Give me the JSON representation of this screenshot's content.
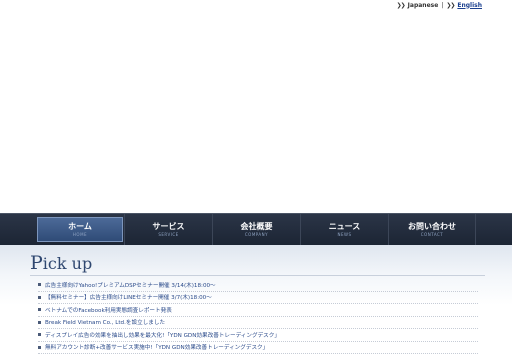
{
  "lang": {
    "japanese": "Japanese",
    "separator": "|",
    "english": "English"
  },
  "nav": {
    "items": [
      {
        "label": "ホーム",
        "sub": "HOME"
      },
      {
        "label": "サービス",
        "sub": "SERVICE"
      },
      {
        "label": "会社概要",
        "sub": "COMPANY"
      },
      {
        "label": "ニュース",
        "sub": "NEWS"
      },
      {
        "label": "お問い合わせ",
        "sub": "CONTACT"
      }
    ]
  },
  "pickup": {
    "title_cap": "P",
    "title_rest": "ick up",
    "items": [
      "広告主様向けYahoo!プレミアムDSPセミナー開催 3/14(木)18:00〜",
      "【無料セミナー】広告主様向けLINEセミナー開催 3/7(木)18:00〜",
      "ベトナムでのFacebook利用実態調査レポート発表",
      "Break Field Vietnam Co., Ltd.を設立しました",
      "ディスプレイ広告の効果を抽出し効果を最大化!「YDN GDN効果改善トレーディングデスク」",
      "無料アカウント診断+改善サービス実施中!「YDN GDN効果改善トレーディングデスク」"
    ]
  }
}
